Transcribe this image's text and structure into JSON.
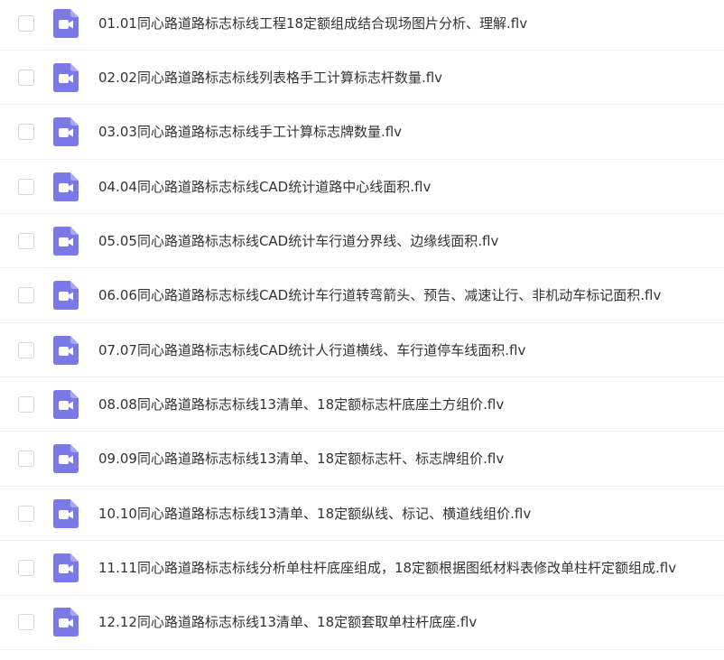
{
  "files": [
    {
      "name": "01.01同心路道路标志标线工程18定额组成结合现场图片分析、理解.flv",
      "icon": "video-file-icon"
    },
    {
      "name": "02.02同心路道路标志标线列表格手工计算标志杆数量.flv",
      "icon": "video-file-icon"
    },
    {
      "name": "03.03同心路道路标志标线手工计算标志牌数量.flv",
      "icon": "video-file-icon"
    },
    {
      "name": "04.04同心路道路标志标线CAD统计道路中心线面积.flv",
      "icon": "video-file-icon"
    },
    {
      "name": "05.05同心路道路标志标线CAD统计车行道分界线、边缘线面积.flv",
      "icon": "video-file-icon"
    },
    {
      "name": "06.06同心路道路标志标线CAD统计车行道转弯箭头、预告、减速让行、非机动车标记面积.flv",
      "icon": "video-file-icon"
    },
    {
      "name": "07.07同心路道路标志标线CAD统计人行道横线、车行道停车线面积.flv",
      "icon": "video-file-icon"
    },
    {
      "name": "08.08同心路道路标志标线13清单、18定额标志杆底座土方组价.flv",
      "icon": "video-file-icon"
    },
    {
      "name": "09.09同心路道路标志标线13清单、18定额标志杆、标志牌组价.flv",
      "icon": "video-file-icon"
    },
    {
      "name": "10.10同心路道路标志标线13清单、18定额纵线、标记、横道线组价.flv",
      "icon": "video-file-icon"
    },
    {
      "name": "11.11同心路道路标志标线分析单柱杆底座组成，18定额根据图纸材料表修改单柱杆定额组成.flv",
      "icon": "video-file-icon"
    },
    {
      "name": "12.12同心路道路标志标线13清单、18定额套取单柱杆底座.flv",
      "icon": "video-file-icon"
    }
  ],
  "colors": {
    "icon_fill": "#7b78e8",
    "text": "#333333",
    "divider": "#eef0f3",
    "checkbox_border": "#d3d6dc"
  }
}
